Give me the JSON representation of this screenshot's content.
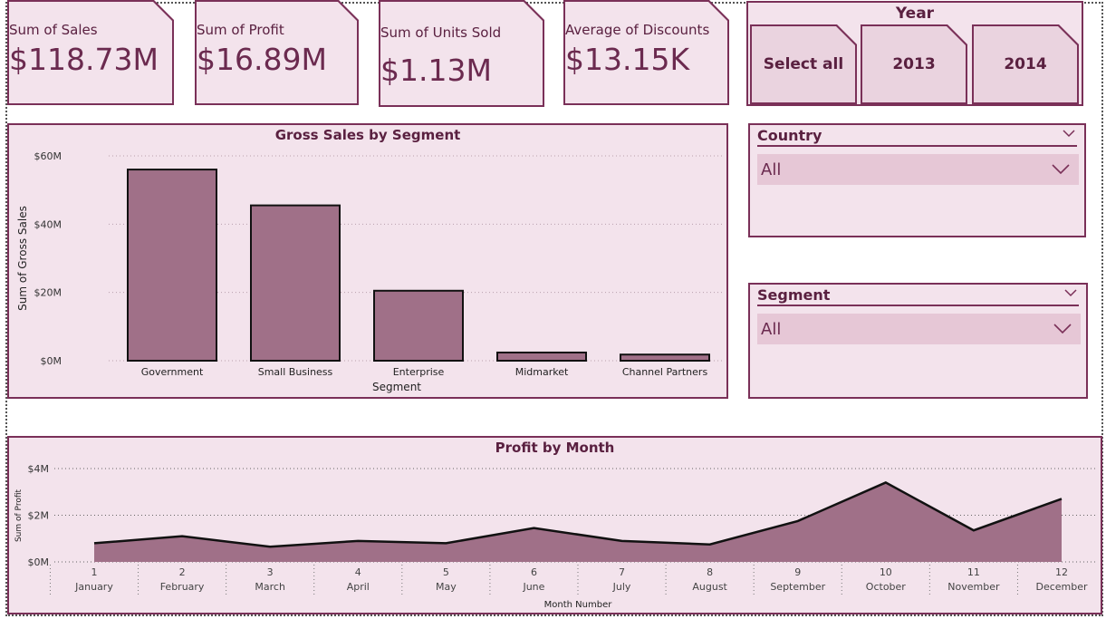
{
  "kpis": [
    {
      "label": "Sum of Sales",
      "value": "$118.73M"
    },
    {
      "label": "Sum of Profit",
      "value": "$16.89M"
    },
    {
      "label": "Sum of Units Sold",
      "value": "$1.13M"
    },
    {
      "label": "Average of Discounts",
      "value": "$13.15K"
    }
  ],
  "year_slicer": {
    "title": "Year",
    "options": [
      "Select all",
      "2013",
      "2014"
    ]
  },
  "country_slicer": {
    "title": "Country",
    "value": "All"
  },
  "segment_slicer": {
    "title": "Segment",
    "value": "All"
  },
  "colors": {
    "accent": "#7a3058",
    "fill": "#a07088",
    "panel": "#f3e3ec"
  },
  "chart_data": [
    {
      "type": "bar",
      "title": "Gross Sales by Segment",
      "xlabel": "Segment",
      "ylabel": "Sum of Gross Sales",
      "categories": [
        "Government",
        "Small Business",
        "Enterprise",
        "Midmarket",
        "Channel Partners"
      ],
      "values": [
        56,
        45.5,
        20.5,
        2.4,
        1.8
      ],
      "ylim": [
        0,
        60
      ],
      "yticks": [
        "$0M",
        "$20M",
        "$40M",
        "$60M"
      ],
      "ytick_values": [
        0,
        20,
        40,
        60
      ],
      "grid": true
    },
    {
      "type": "area",
      "title": "Profit by Month",
      "xlabel": "Month Number",
      "ylabel": "Sum of Profit",
      "x": [
        1,
        2,
        3,
        4,
        5,
        6,
        7,
        8,
        9,
        10,
        11,
        12
      ],
      "x_names": [
        "January",
        "February",
        "March",
        "April",
        "May",
        "June",
        "July",
        "August",
        "September",
        "October",
        "November",
        "December"
      ],
      "values": [
        0.8,
        1.1,
        0.65,
        0.9,
        0.8,
        1.45,
        0.9,
        0.75,
        1.75,
        3.4,
        1.35,
        2.7
      ],
      "ylim": [
        0,
        4
      ],
      "yticks": [
        "$0M",
        "$2M",
        "$4M"
      ],
      "ytick_values": [
        0,
        2,
        4
      ],
      "grid": true
    }
  ]
}
